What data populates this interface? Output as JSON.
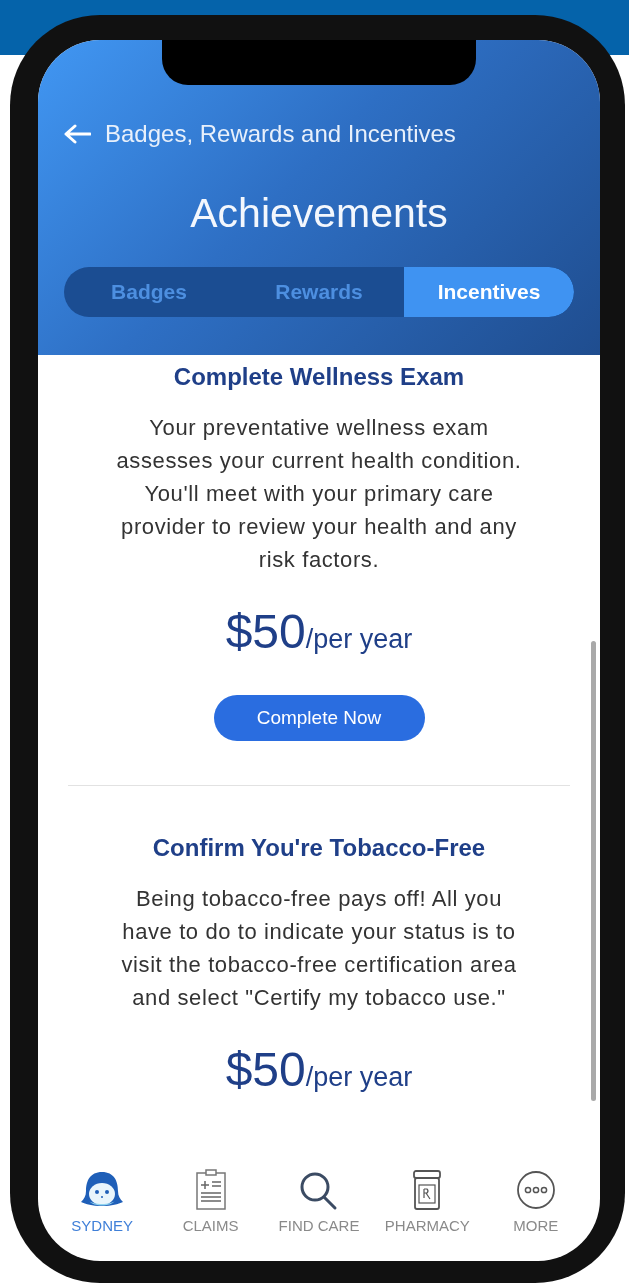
{
  "header": {
    "back_label": "Badges, Rewards and Incentives",
    "title": "Achievements"
  },
  "tabs": [
    {
      "label": "Badges",
      "selected": false
    },
    {
      "label": "Rewards",
      "selected": false
    },
    {
      "label": "Incentives",
      "selected": true
    }
  ],
  "incentives": [
    {
      "title": "Complete Wellness Exam",
      "description": "Your preventative wellness exam assesses your current health condition. You'll meet with your primary care provider to review your health and any risk factors.",
      "amount": "$50",
      "period": "/per year",
      "button": "Complete Now"
    },
    {
      "title": "Confirm You're Tobacco-Free",
      "description": "Being tobacco-free pays off! All you have to do to indicate your status is to visit the tobacco-free certification area and select \"Certify my tobacco use.\"",
      "amount": "$50",
      "period": "/per year"
    }
  ],
  "bottom_nav": [
    {
      "label": "SYDNEY",
      "kind": "avatar",
      "selected": true
    },
    {
      "label": "CLAIMS",
      "kind": "clipboard",
      "selected": false
    },
    {
      "label": "FIND CARE",
      "kind": "search",
      "selected": false
    },
    {
      "label": "PHARMACY",
      "kind": "bottle",
      "selected": false
    },
    {
      "label": "MORE",
      "kind": "more",
      "selected": false
    }
  ]
}
